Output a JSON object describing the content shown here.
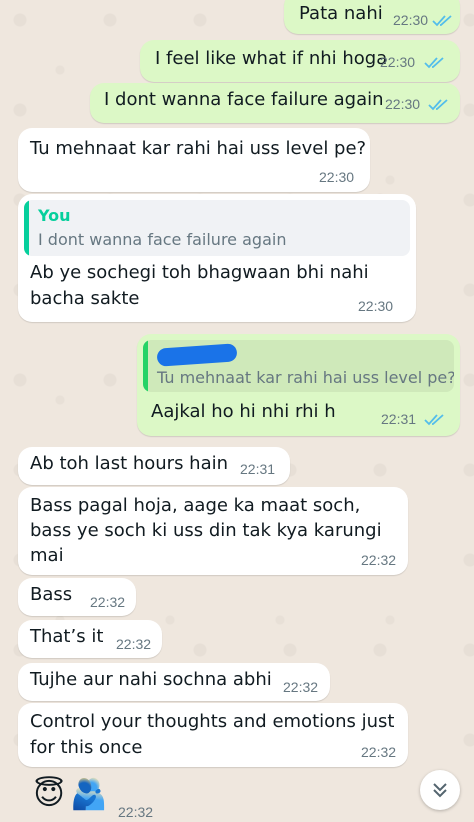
{
  "chat": {
    "colors": {
      "incoming_bubble": "#ffffff",
      "outgoing_bubble": "#dcf8c6",
      "read_ticks": "#53bdeb",
      "quote_author": "#06cf9c",
      "quote_bar_outgoing": "#25d366",
      "redacted": "#1a73e8"
    },
    "messages": [
      {
        "direction": "out",
        "text": "Pata nahi",
        "time": "22:30",
        "status": "read"
      },
      {
        "direction": "out",
        "text": "I feel like what if nhi hoga",
        "time": "22:30",
        "status": "read"
      },
      {
        "direction": "out",
        "text": "I dont wanna face failure again",
        "time": "22:30",
        "status": "read"
      },
      {
        "direction": "in",
        "text": "Tu mehnaat kar rahi hai uss level pe?",
        "time": "22:30"
      },
      {
        "direction": "in",
        "quote_author": "You",
        "quote_text": "I dont wanna face failure again",
        "text_line1": "Ab ye sochegi toh bhagwaan bhi nahi",
        "text_line2": "bacha sakte",
        "time": "22:30"
      },
      {
        "direction": "out",
        "quote_text": "Tu mehnaat kar rahi hai uss level pe?",
        "text": "Aajkal ho hi nhi rhi h",
        "time": "22:31",
        "status": "read"
      },
      {
        "direction": "in",
        "text": "Ab toh last hours hain",
        "time": "22:31"
      },
      {
        "direction": "in",
        "text_line1": "Bass pagal hoja, aage ka maat soch,",
        "text_line2": "bass ye soch ki uss din tak kya karungi",
        "text_line3": "mai",
        "time": "22:32"
      },
      {
        "direction": "in",
        "text": "Bass",
        "time": "22:32"
      },
      {
        "direction": "in",
        "text": "That’s it",
        "time": "22:32"
      },
      {
        "direction": "in",
        "text": "Tujhe aur nahi sochna abhi",
        "time": "22:32"
      },
      {
        "direction": "in",
        "text_line1": "Control your thoughts and emotions just",
        "text_line2": "for this once",
        "time": "22:32"
      },
      {
        "direction": "in",
        "emojis": [
          "😇",
          "🫂"
        ],
        "time": "22:32"
      }
    ],
    "scroll_button_icon": "double-chevron-down-icon"
  }
}
